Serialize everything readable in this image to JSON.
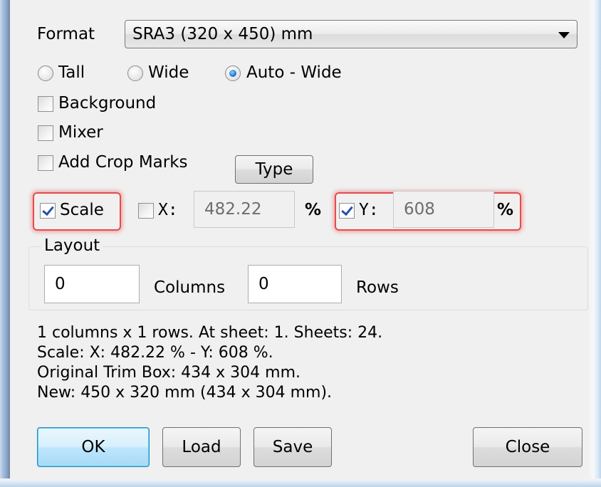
{
  "format": {
    "label": "Format",
    "value": "SRA3 (320 x 450) mm"
  },
  "orientation": {
    "options": [
      {
        "label": "Tall",
        "checked": false
      },
      {
        "label": "Wide",
        "checked": false
      },
      {
        "label": "Auto - Wide",
        "checked": true
      }
    ]
  },
  "options": {
    "background": {
      "label": "Background",
      "checked": false
    },
    "mixer": {
      "label": "Mixer",
      "checked": false
    },
    "crop_marks": {
      "label": "Add Crop Marks",
      "checked": false
    },
    "type_button": "Type"
  },
  "scale": {
    "label": "Scale",
    "checked": true,
    "x_label": "X:",
    "x_checked": false,
    "x_value": "482.22",
    "x_unit": "%",
    "y_label": "Y:",
    "y_checked": true,
    "y_value": "608",
    "y_unit": "%"
  },
  "layout": {
    "title": "Layout",
    "columns_value": "0",
    "columns_label": "Columns",
    "rows_value": "0",
    "rows_label": "Rows"
  },
  "info": {
    "line1": "1 columns x 1 rows. At sheet: 1. Sheets: 24.",
    "line2": "Scale: X: 482.22 % - Y: 608 %.",
    "line3": "Original Trim Box: 434 x 304 mm.",
    "line4": "New: 450 x 320 mm (434 x 304 mm)."
  },
  "buttons": {
    "ok": "OK",
    "load": "Load",
    "save": "Save",
    "close": "Close"
  },
  "colors": {
    "highlight": "#e84a4a",
    "check_color": "#264ea8",
    "default_button": "#bee6fd"
  }
}
